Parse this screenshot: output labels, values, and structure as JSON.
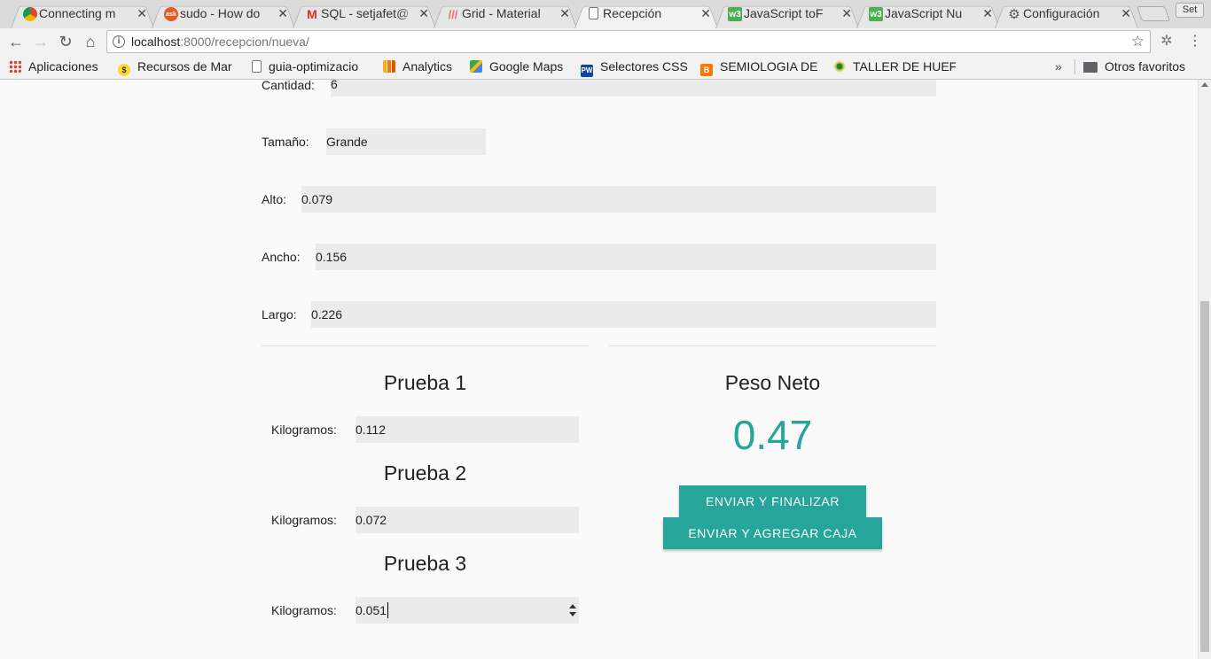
{
  "browser": {
    "tabs": [
      {
        "title": "Connecting m",
        "icon": "chrome-icon",
        "active": false
      },
      {
        "title": "sudo - How do",
        "icon": "askubuntu-icon",
        "active": false
      },
      {
        "title": "SQL - setjafet@",
        "icon": "gmail-icon",
        "active": false
      },
      {
        "title": "Grid - Material",
        "icon": "materialize-icon",
        "active": false
      },
      {
        "title": "Recepción",
        "icon": "page-icon",
        "active": true
      },
      {
        "title": "JavaScript toF",
        "icon": "w3schools-icon",
        "active": false
      },
      {
        "title": "JavaScript Nu",
        "icon": "w3schools-icon",
        "active": false
      },
      {
        "title": "Configuración",
        "icon": "gear-icon",
        "active": false
      }
    ],
    "set_button": "Set",
    "url_host": "localhost",
    "url_path": ":8000/recepcion/nueva/",
    "bookmarks": [
      {
        "label": "Aplicaciones",
        "icon": "apps-grid-icon"
      },
      {
        "label": "Recursos de Mar",
        "icon": "bookmark-icon"
      },
      {
        "label": "guia-optimizacio",
        "icon": "document-icon"
      },
      {
        "label": "Analytics",
        "icon": "analytics-icon"
      },
      {
        "label": "Google Maps",
        "icon": "maps-icon"
      },
      {
        "label": "Selectores CSS",
        "icon": "pw-icon"
      },
      {
        "label": "SEMIOLOGIA DE",
        "icon": "blogger-icon"
      },
      {
        "label": "TALLER DE HUEF",
        "icon": "eye-icon"
      }
    ],
    "more_bookmarks": "»",
    "other_bookmarks": "Otros favoritos"
  },
  "form": {
    "cantidad": {
      "label": "Cantidad:",
      "value": "6"
    },
    "tamano": {
      "label": "Tamaño:",
      "value": "Grande"
    },
    "alto": {
      "label": "Alto:",
      "value": "0.079"
    },
    "ancho": {
      "label": "Ancho:",
      "value": "0.156"
    },
    "largo": {
      "label": "Largo:",
      "value": "0.226"
    }
  },
  "pruebas": [
    {
      "title": "Prueba 1",
      "label": "Kilogramos:",
      "value": "0.112"
    },
    {
      "title": "Prueba 2",
      "label": "Kilogramos:",
      "value": "0.072"
    },
    {
      "title": "Prueba 3",
      "label": "Kilogramos:",
      "value": "0.051"
    }
  ],
  "peso": {
    "title": "Peso Neto",
    "value": "0.47"
  },
  "actions": {
    "finalizar": "ENVIAR Y FINALIZAR",
    "agregar": "ENVIAR Y AGREGAR CAJA"
  },
  "colors": {
    "accent": "#26a69a",
    "input_bg": "#ebebeb",
    "page_bg": "#fafafa"
  }
}
